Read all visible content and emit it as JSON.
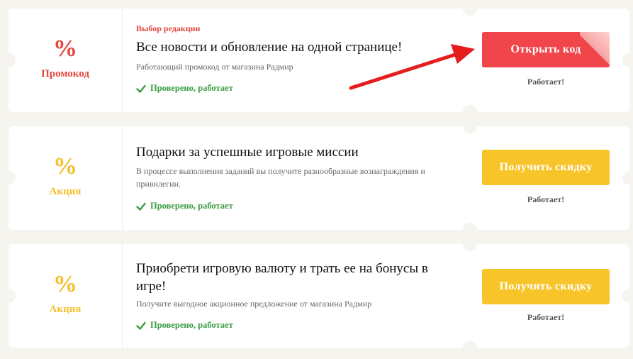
{
  "coupons": [
    {
      "percent_symbol": "%",
      "type_label": "Промокод",
      "editor_pick": "Выбор редакции",
      "title": "Все новости и обновление на одной странице!",
      "description": "Работающий промокод от магазина Радмир",
      "verified": "Проверено, работает",
      "button_label": "Открыть код",
      "status": "Работает!"
    },
    {
      "percent_symbol": "%",
      "type_label": "Акция",
      "title": "Подарки за успешные игровые миссии",
      "description": "В процессе выполнения заданий вы получите разнообразные вознаграждения и привилегии.",
      "verified": "Проверено, работает",
      "button_label": "Получить скидку",
      "status": "Работает!"
    },
    {
      "percent_symbol": "%",
      "type_label": "Акция",
      "title": "Приобрети игровую валюту и трать ее на бонусы в игре!",
      "description": "Получите выгодное акционное предложение от магазина Радмир",
      "verified": "Проверено, работает",
      "button_label": "Получить скидку",
      "status": "Работает!"
    }
  ],
  "colors": {
    "promo_red": "#e2463d",
    "button_red": "#f0464b",
    "action_yellow": "#f4c02c",
    "button_yellow": "#f7c52a",
    "verified_green": "#3a9c40",
    "page_background": "#f6f4ef"
  },
  "icons": {
    "check": "check-icon",
    "arrow": "red-arrow-annotation"
  }
}
